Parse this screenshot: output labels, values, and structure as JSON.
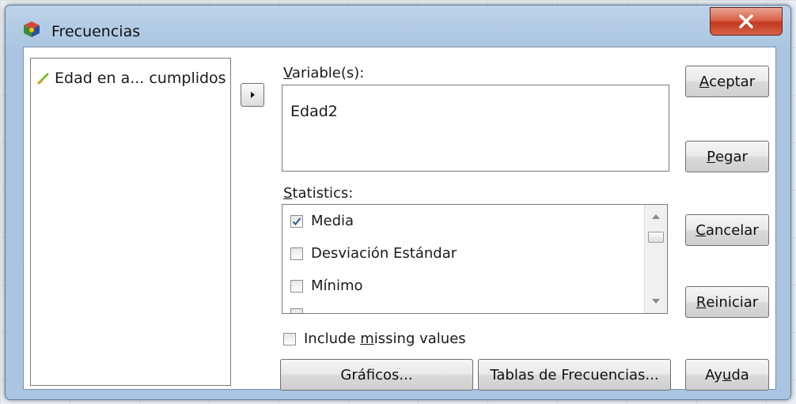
{
  "window": {
    "title": "Frecuencias",
    "close_label": "X"
  },
  "source_variables": [
    {
      "label": "Edad en a... cumplidos",
      "icon": "scale-variable-icon"
    }
  ],
  "variables": {
    "label_underlined": "V",
    "label_rest": "ariable(s):",
    "items": [
      "Edad2"
    ]
  },
  "statistics": {
    "label_underlined": "S",
    "label_rest": "tatistics:",
    "items": [
      {
        "label": "Media",
        "checked": true
      },
      {
        "label": "Desviación Estándar",
        "checked": false
      },
      {
        "label": "Mínimo",
        "checked": false
      }
    ]
  },
  "include_missing": {
    "before": "Include ",
    "underlined": "m",
    "after": "issing values",
    "checked": false
  },
  "buttons": {
    "aceptar": {
      "u": "A",
      "rest": "ceptar"
    },
    "pegar": {
      "u": "P",
      "rest": "egar"
    },
    "cancelar": {
      "u": "C",
      "rest": "ancelar"
    },
    "reiniciar": {
      "u": "R",
      "rest": "einiciar"
    },
    "graficos": "Gráficos...",
    "tablas": "Tablas de Frecuencias...",
    "ayuda": {
      "pre": "Ay",
      "u": "u",
      "rest": "da"
    }
  },
  "colors": {
    "close_button": "#c13a1e",
    "title_bar": "#a9c5e1",
    "checkmark": "#2f5e96"
  }
}
